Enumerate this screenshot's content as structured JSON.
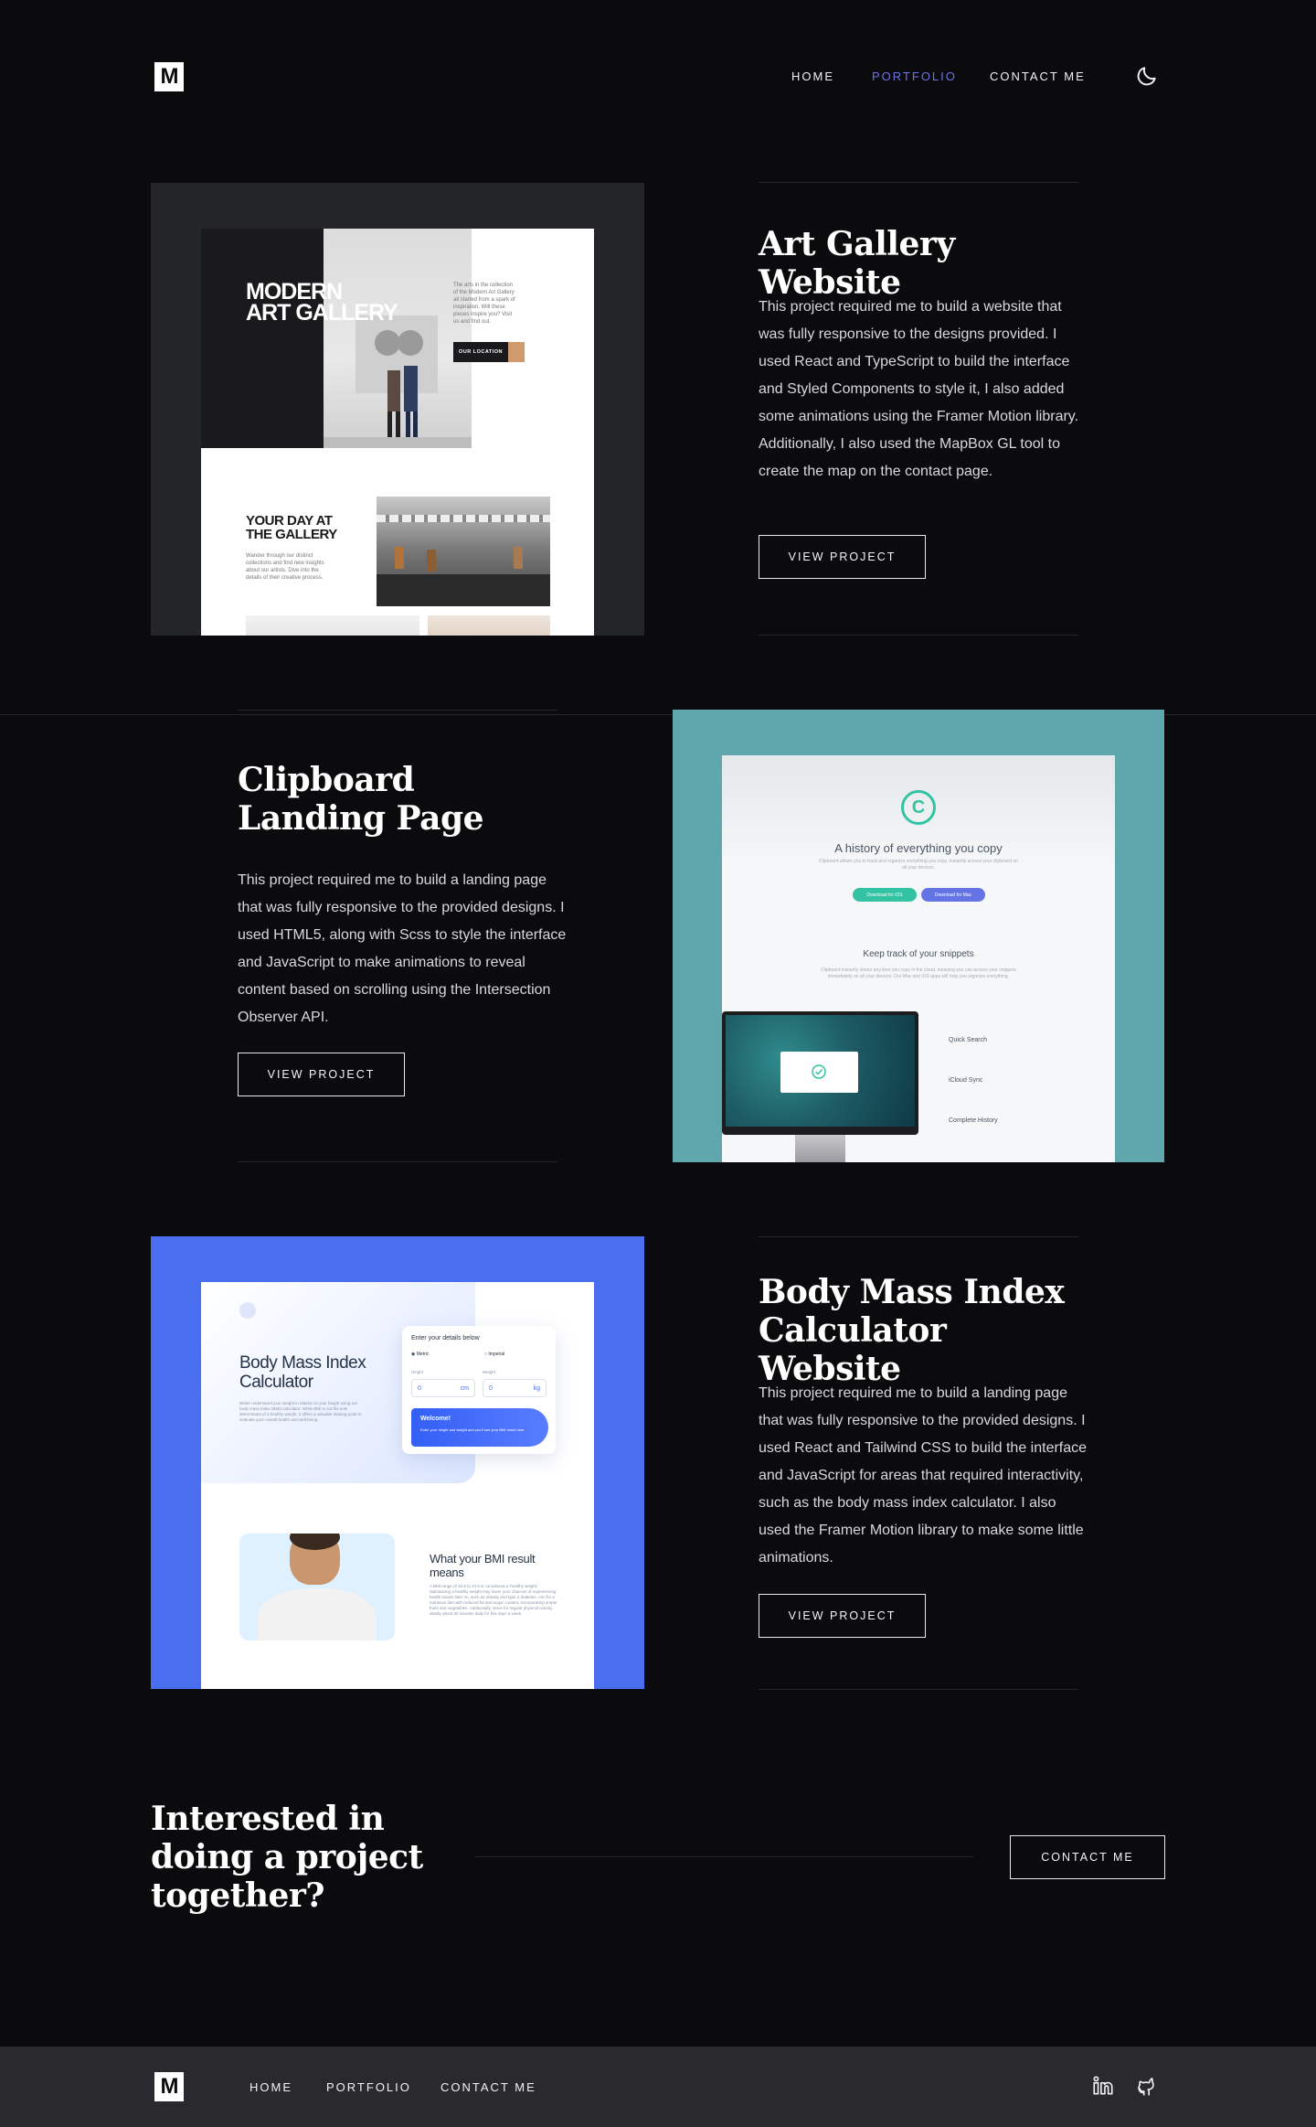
{
  "header": {
    "logo": "M",
    "nav": [
      {
        "label": "HOME"
      },
      {
        "label": "PORTFOLIO"
      },
      {
        "label": "CONTACT ME"
      }
    ]
  },
  "projects": [
    {
      "title": "Art Gallery Website",
      "description": "This project required me to build a website that was fully responsive to the designs provided. I used React and TypeScript to build the interface and Styled Components to style it, I also added some animations using the Framer Motion library. Additionally, I also used the MapBox GL tool to create the map on the contact page.",
      "button": "VIEW PROJECT",
      "preview": {
        "heading_line1": "MODERN",
        "heading_line2": "ART GALLERY",
        "intro": "The arts in the collection of the Modern Art Gallery all started from a spark of inspiration. Will these pieces inspire you? Visit us and find out.",
        "cta": "OUR LOCATION",
        "section_heading_line1": "YOUR DAY AT",
        "section_heading_line2": "THE GALLERY",
        "section_text": "Wander through our distinct collections and find new insights about our artists. Dive into the details of their creative process."
      }
    },
    {
      "title": "Clipboard Landing Page",
      "description": "This project required me to build a landing page that was fully responsive to the provided designs. I used HTML5, along with Scss to style the interface and JavaScript to make animations to reveal content based on scrolling using the Intersection Observer API.",
      "button": "VIEW PROJECT",
      "preview": {
        "headline": "A history of everything you copy",
        "subline": "Clipboard allows you to track and organize everything you copy. Instantly access your clipboard on all your devices.",
        "btn_ios": "Download for iOS",
        "btn_mac": "Download for Mac",
        "section_heading": "Keep track of your snippets",
        "section_text": "Clipboard instantly stores any item you copy in the cloud, meaning you can access your snippets immediately on all your devices. Our Mac and iOS apps will help you organize everything.",
        "features": [
          "Quick Search",
          "iCloud Sync",
          "Complete History"
        ]
      }
    },
    {
      "title": "Body Mass Index Calculator Website",
      "description": "This project required me to build a landing page that was fully responsive to the provided designs. I used React and Tailwind CSS to build the interface and JavaScript for areas that required interactivity, such as the body mass index calculator. I also used the Framer Motion library to make some little animations.",
      "button": "VIEW PROJECT",
      "preview": {
        "title": "Body Mass Index Calculator",
        "intro": "Better understand your weight in relation to your height using our body mass index (BMI) calculator. While BMI is not the sole determinant of a healthy weight, it offers a valuable starting point to evaluate your overall health and well-being.",
        "form_title": "Enter your details below",
        "unit_metric": "Metric",
        "unit_imperial": "Imperial",
        "height_label": "Height",
        "weight_label": "Weight",
        "height_value": "0",
        "height_unit": "cm",
        "weight_value": "0",
        "weight_unit": "kg",
        "welcome_title": "Welcome!",
        "welcome_text": "Enter your height and weight and you'll see your BMI result here",
        "result_heading": "What your BMI result means",
        "result_text": "A BMI range of 18.5 to 24.9 is considered a 'healthy weight.' Maintaining a healthy weight may lower your chances of experiencing health issues later on, such as obesity and type 2 diabetes. Aim for a nutritious diet with reduced fat and sugar content, incorporating ample fruits and vegetables. Additionally, strive for regular physical activity, ideally about 30 minutes daily for five days a week."
      }
    }
  ],
  "cta": {
    "title": "Interested in doing a project together?",
    "button": "CONTACT ME"
  },
  "footer": {
    "logo": "M",
    "nav": [
      {
        "label": "HOME"
      },
      {
        "label": "PORTFOLIO"
      },
      {
        "label": "CONTACT ME"
      }
    ],
    "social": [
      "linkedin-icon",
      "github-icon"
    ]
  },
  "colors": {
    "background": "#0b0b0e",
    "accent": "#6b74e8",
    "footer": "#2a2a2e",
    "rule": "#25252b"
  }
}
